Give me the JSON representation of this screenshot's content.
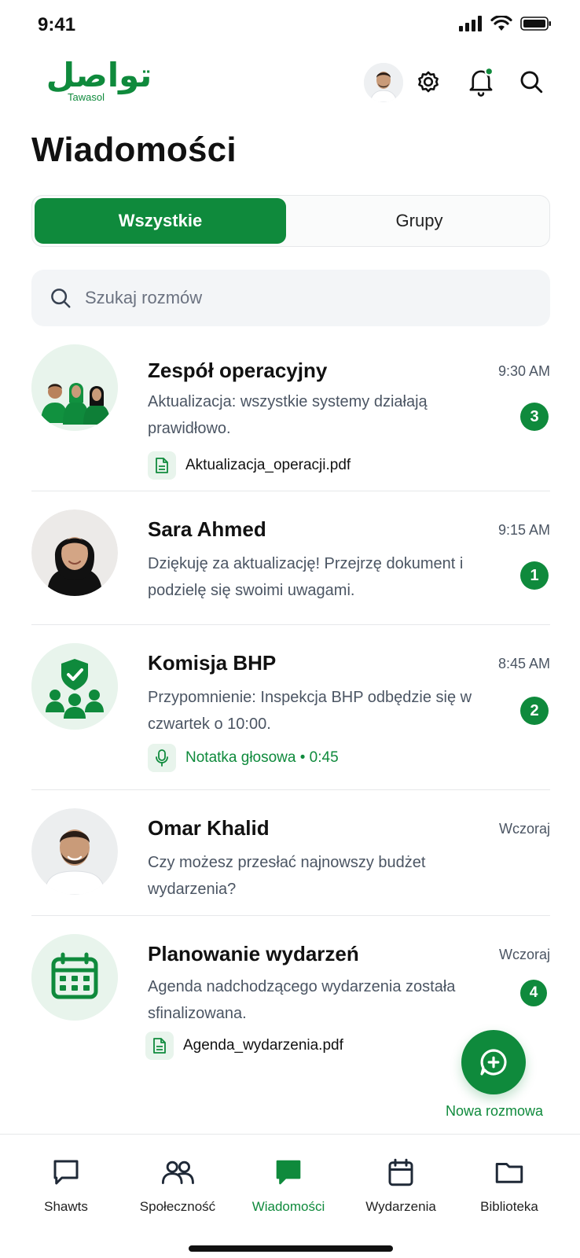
{
  "status_bar": {
    "time": "9:41"
  },
  "header": {
    "logo_text": "تواصل",
    "logo_sub": "Tawasol",
    "page_title": "Wiadomości"
  },
  "tabs": [
    {
      "label": "Wszystkie",
      "active": true
    },
    {
      "label": "Grupy",
      "active": false
    }
  ],
  "search": {
    "placeholder": "Szukaj rozmów"
  },
  "conversations": [
    {
      "name": "Zespół operacyjny",
      "time": "9:30 AM",
      "message": "Aktualizacja: wszystkie systemy działają prawidłowo.",
      "badge": "3",
      "attachment": "Aktualizacja_operacji.pdf",
      "avatar_icon": "team-icon"
    },
    {
      "name": "Sara Ahmed",
      "time": "9:15 AM",
      "message": "Dziękuję za aktualizację! Przejrzę dokument i podzielę się swoimi uwagami.",
      "badge": "1",
      "avatar_icon": "person-avatar"
    },
    {
      "name": "Komisja BHP",
      "time": "8:45 AM",
      "message": "Przypomnienie: Inspekcja BHP odbędzie się w czwartek o 10:00.",
      "badge": "2",
      "voice_note": "Notatka głosowa • 0:45",
      "avatar_icon": "shield-group-icon"
    },
    {
      "name": "Omar Khalid",
      "time": "Wczoraj",
      "message": "Czy możesz przesłać najnowszy budżet wydarzenia?",
      "avatar_icon": "person-avatar"
    },
    {
      "name": "Planowanie wydarzeń",
      "time": "Wczoraj",
      "message": "Agenda nadchodzącego wydarzenia została sfinalizowana.",
      "badge": "4",
      "attachment": "Agenda_wydarzenia.pdf",
      "avatar_icon": "calendar-icon"
    }
  ],
  "fab": {
    "label": "Nowa rozmowa",
    "icon": "chat-plus-icon"
  },
  "bottom_nav": [
    {
      "label": "Shawts",
      "icon": "chat-outline-icon",
      "active": false
    },
    {
      "label": "Społeczność",
      "icon": "people-icon",
      "active": false
    },
    {
      "label": "Wiadomości",
      "icon": "chat-filled-icon",
      "active": true
    },
    {
      "label": "Wydarzenia",
      "icon": "calendar-icon",
      "active": false
    },
    {
      "label": "Biblioteka",
      "icon": "folder-icon",
      "active": false
    }
  ],
  "colors": {
    "brand": "#0f8a3c",
    "brand_light": "#e8f4ec",
    "text_muted": "#4b5563"
  }
}
